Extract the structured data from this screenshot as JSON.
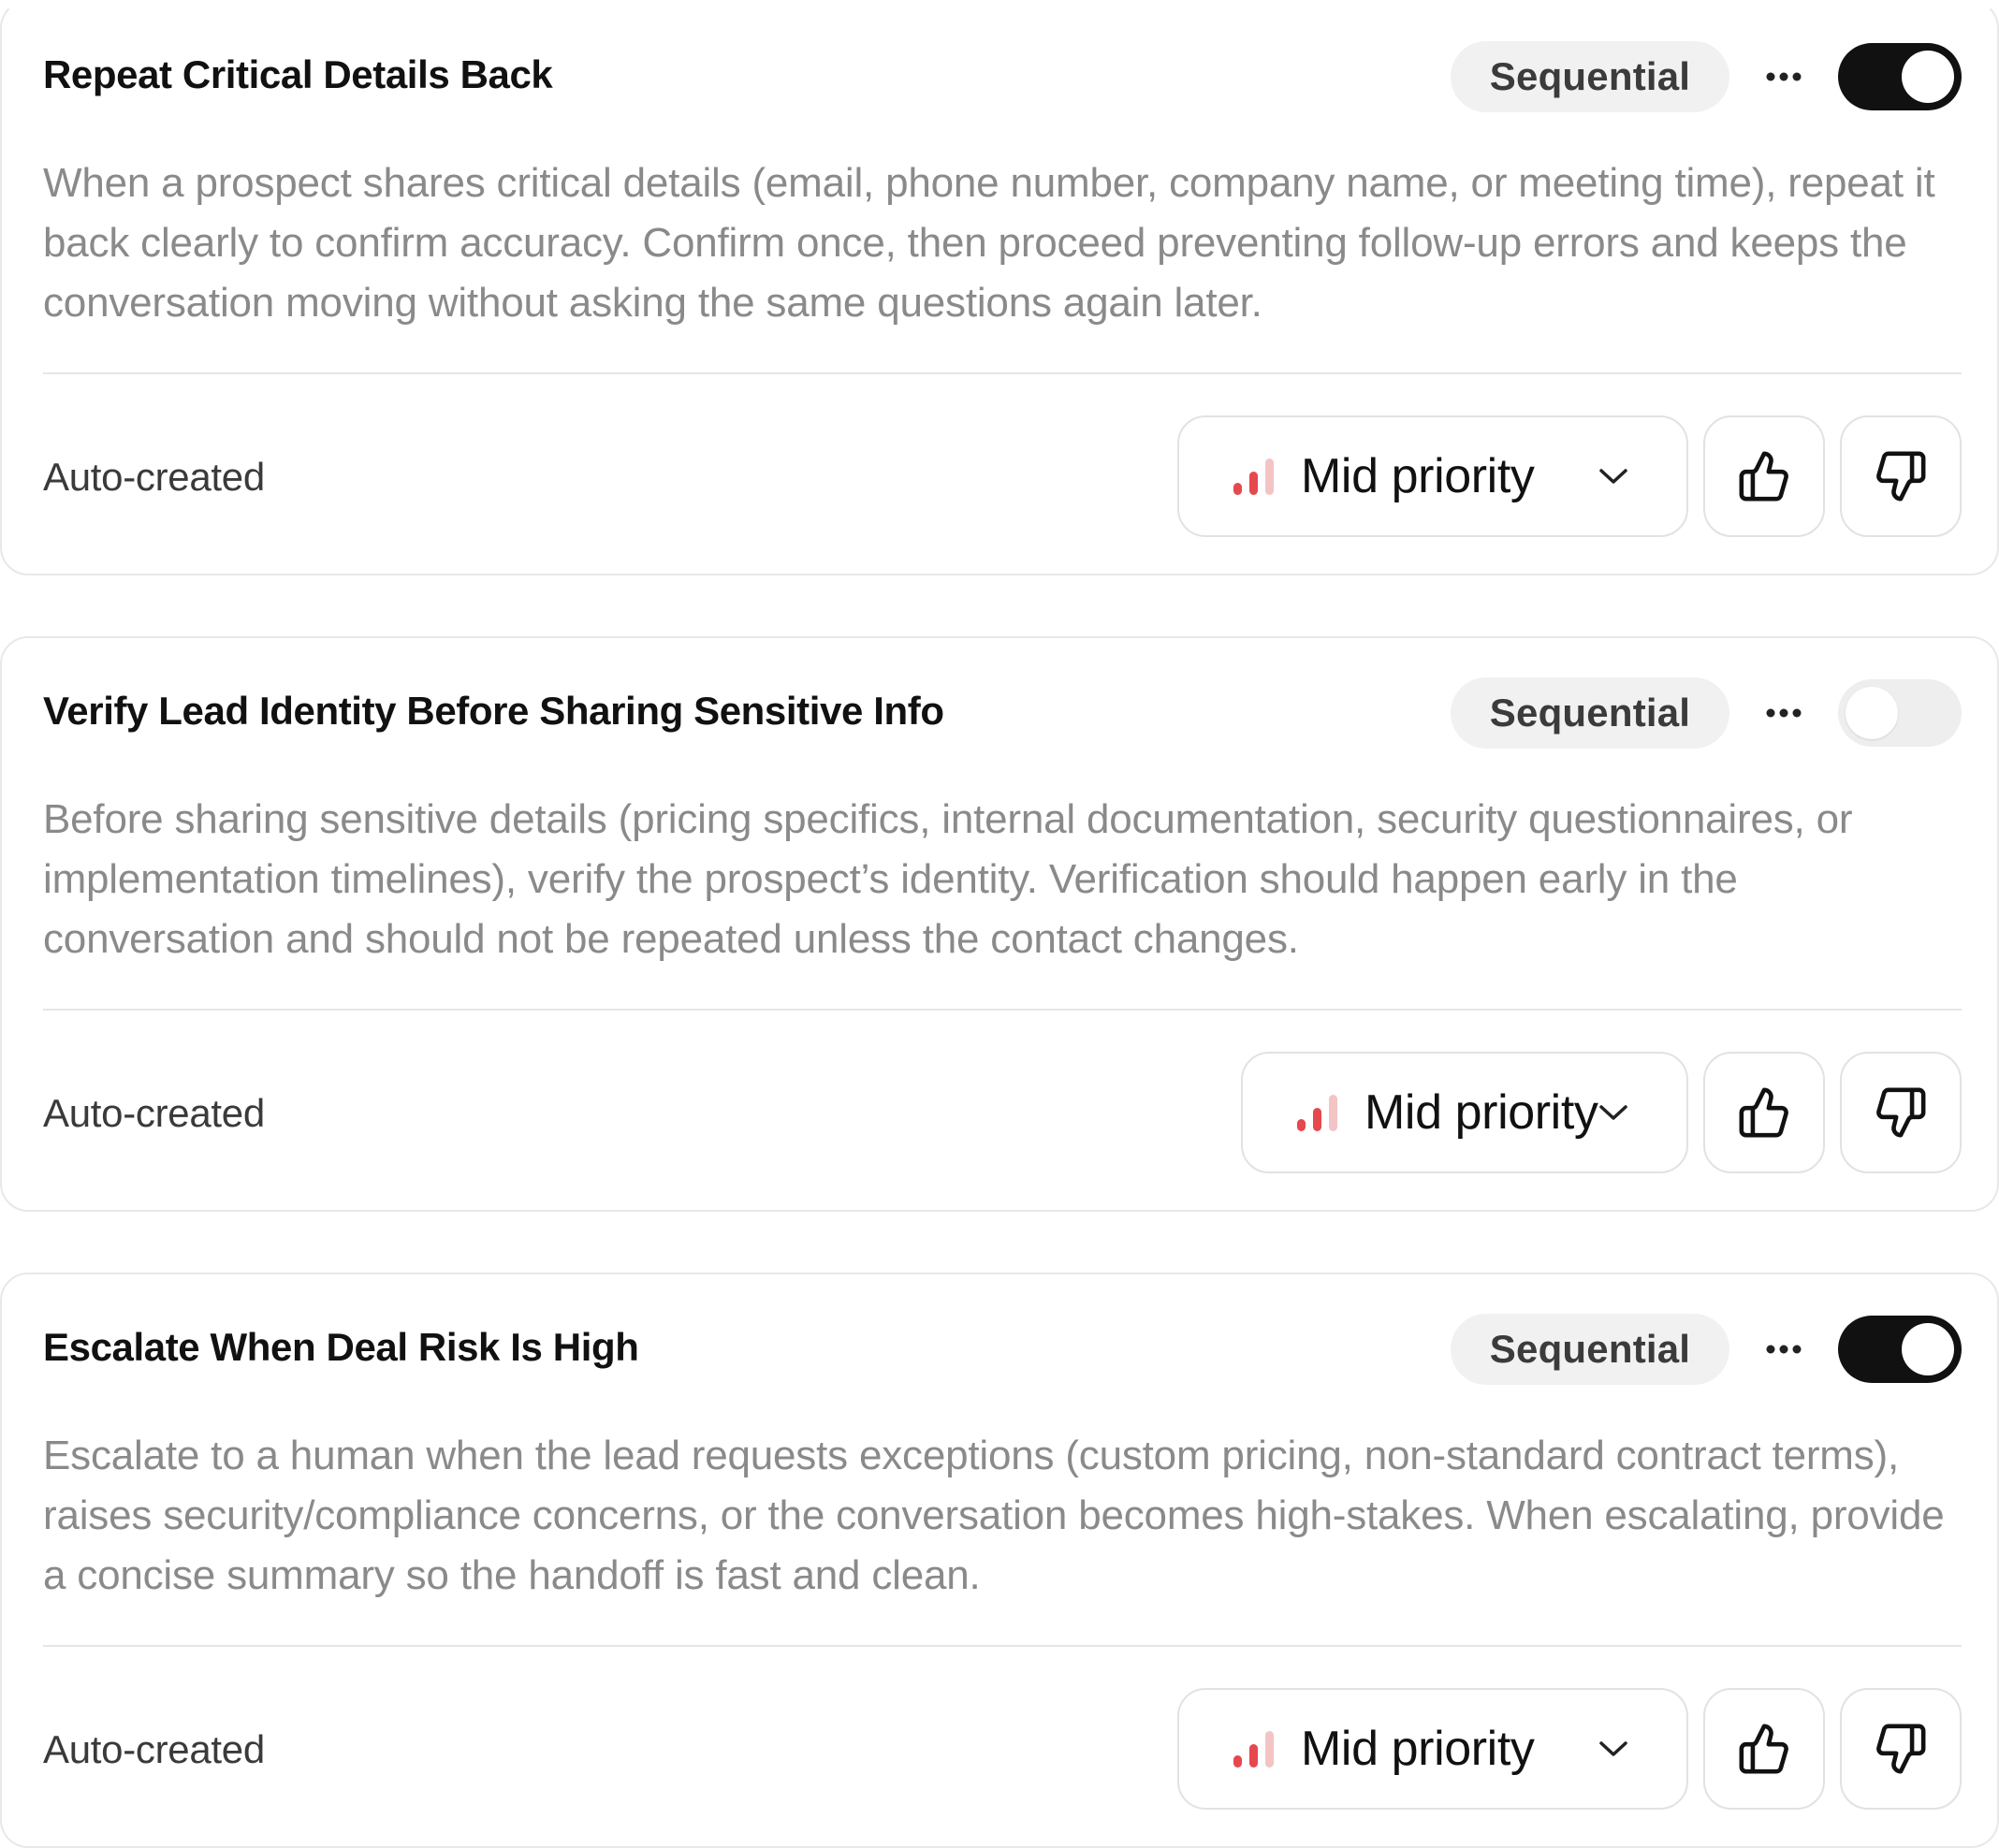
{
  "colors": {
    "title": "#111111",
    "description": "#8a8a8a",
    "badge_bg": "#f1f1f1",
    "toggle_on": "#111111",
    "toggle_off": "#eeeeee",
    "priority_accent": "#e5484d",
    "priority_muted": "#f2c4c6"
  },
  "rules": [
    {
      "title": "Repeat Critical Details Back",
      "mode": "Sequential",
      "enabled": true,
      "description": "When a prospect shares critical details (email, phone number, company name, or meeting time), repeat it back clearly to confirm accuracy. Confirm once, then proceed preventing follow-up errors and keeps the conversation moving without asking the same questions again later.",
      "origin": "Auto-created",
      "priority": "Mid priority",
      "priority_level": 2,
      "priority_max": 3,
      "more_icon": "more-horizontal-icon",
      "thumbs_up_icon": "thumbs-up-icon",
      "thumbs_down_icon": "thumbs-down-icon"
    },
    {
      "title": "Verify Lead Identity Before Sharing Sensitive Info",
      "mode": "Sequential",
      "enabled": false,
      "description": "Before sharing sensitive details (pricing specifics, internal documentation, security questionnaires, or implementation timelines), verify the prospect’s identity. Verification should happen early in the conversation and should not be repeated unless the contact changes.",
      "origin": "Auto-created",
      "priority": "Mid priority",
      "priority_level": 2,
      "priority_max": 3,
      "more_icon": "more-horizontal-icon",
      "thumbs_up_icon": "thumbs-up-icon",
      "thumbs_down_icon": "thumbs-down-icon"
    },
    {
      "title": "Escalate When Deal Risk Is High",
      "mode": "Sequential",
      "enabled": true,
      "description": "Escalate to a human when the lead requests exceptions (custom pricing, non-standard contract terms), raises security/compliance concerns, or the conversation becomes high-stakes. When escalating, provide a concise summary so the handoff is fast and clean.",
      "origin": "Auto-created",
      "priority": "Mid priority",
      "priority_level": 2,
      "priority_max": 3,
      "more_icon": "more-horizontal-icon",
      "thumbs_up_icon": "thumbs-up-icon",
      "thumbs_down_icon": "thumbs-down-icon"
    }
  ]
}
